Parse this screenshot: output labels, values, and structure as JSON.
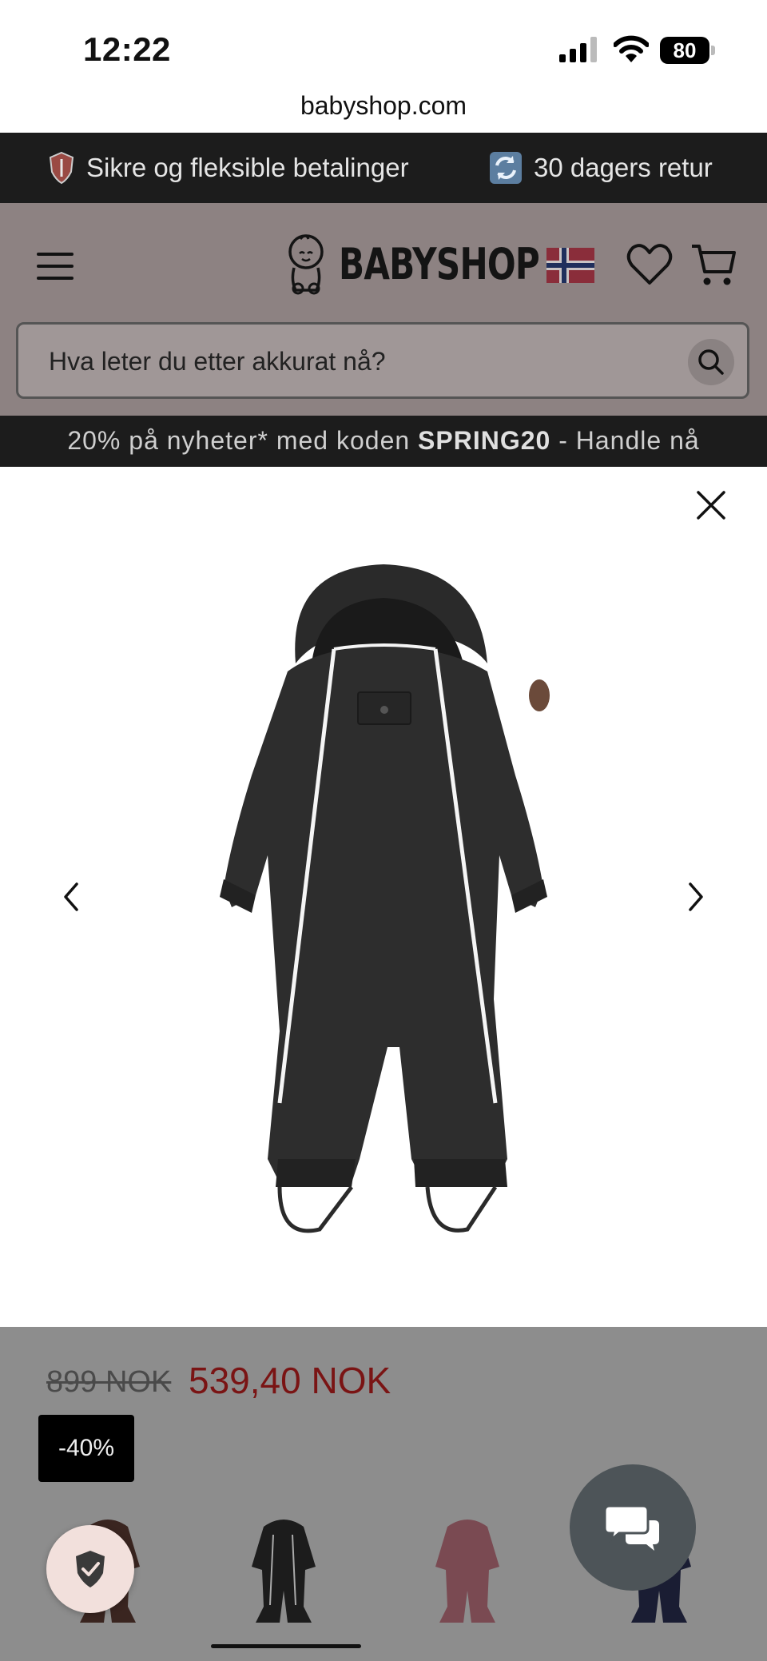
{
  "status_bar": {
    "time": "12:22",
    "battery": "80"
  },
  "browser": {
    "url": "babyshop.com"
  },
  "topbar": {
    "item1": "Sikre og fleksible betalinger",
    "item2": "30 dagers retur"
  },
  "header": {
    "logo_text": "BABYSHOP"
  },
  "search": {
    "placeholder": "Hva leter du etter akkurat nå?"
  },
  "promo": {
    "prefix": "20% på nyheter* med koden ",
    "code": "SPRING20",
    "suffix": " - Handle nå"
  },
  "product": {
    "old_price": "899 NOK",
    "new_price": "539,40 NOK",
    "discount_badge": "-40%"
  },
  "thumbnails": [
    {
      "color": "brown"
    },
    {
      "color": "black"
    },
    {
      "color": "rose"
    },
    {
      "color": "navy"
    }
  ],
  "colors": {
    "topbar_bg": "#1c1c1c",
    "header_bg": "#8d8282",
    "sale_price": "#7a1414",
    "chat_bg": "#4d5458"
  }
}
